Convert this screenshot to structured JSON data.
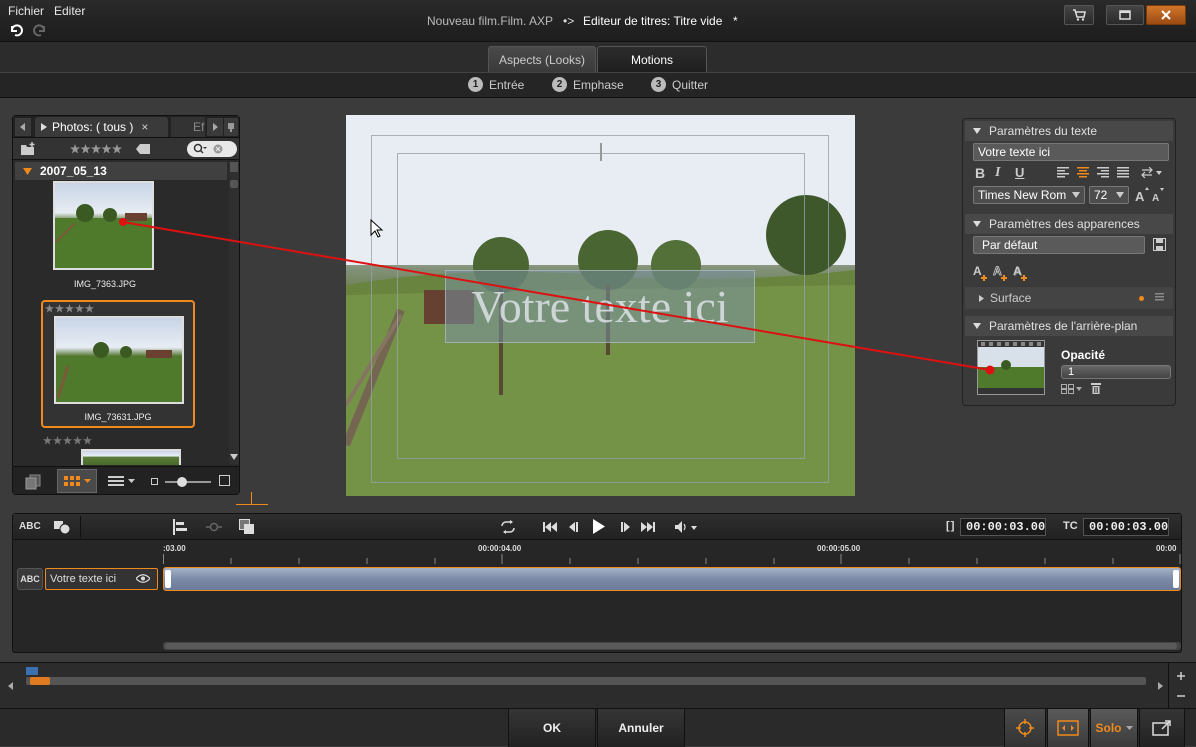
{
  "menu": {
    "file": "Fichier",
    "edit": "Editer"
  },
  "titlebar": {
    "project": "Nouveau film.Film. AXP",
    "separator": "•>",
    "editor": "Editeur de titres: Titre vide",
    "modified_marker": "*"
  },
  "tabs": [
    {
      "label": "Aspects (Looks)"
    },
    {
      "label": "Motions"
    }
  ],
  "steps": [
    {
      "num": "1",
      "label": "Entrée"
    },
    {
      "num": "2",
      "label": "Emphase"
    },
    {
      "num": "3",
      "label": "Quitter"
    }
  ],
  "library": {
    "tab_label": "Photos: ( tous )",
    "tab_close": "×",
    "next_tab_partial": "Ef",
    "folder": "2007_05_13",
    "items": [
      {
        "name": "IMG_7363.JPG",
        "selected": false
      },
      {
        "name": "IMG_73631.JPG",
        "selected": true
      }
    ]
  },
  "preview": {
    "overlay_text": "Votre texte ici"
  },
  "text_params": {
    "header": "Paramètres du texte",
    "text_value": "Votre texte ici",
    "font": "Times New Rom",
    "size": "72",
    "bold": "B",
    "italic": "I",
    "underline": "U"
  },
  "appearance_params": {
    "header": "Paramètres des apparences",
    "preset": "Par défaut",
    "surface_label": "Surface"
  },
  "background_params": {
    "header": "Paramètres de l'arrière-plan",
    "opacity_label": "Opacité",
    "opacity_value": "1"
  },
  "timeline": {
    "abc_label": "ABC",
    "in_bracket": "[ ]",
    "duration": "00:00:03.00",
    "tc_label": "TC",
    "timecode": "00:00:03.00",
    "ruler": [
      ":03.00",
      "00:00:04.00",
      "00:00:05.00",
      "00:00"
    ],
    "track_name": "Votre texte ici"
  },
  "bottom": {
    "ok": "OK",
    "cancel": "Annuler",
    "solo": "Solo"
  },
  "colors": {
    "accent": "#f08a1c",
    "connector": "#dd1111",
    "clip": "#8a9ab8"
  }
}
